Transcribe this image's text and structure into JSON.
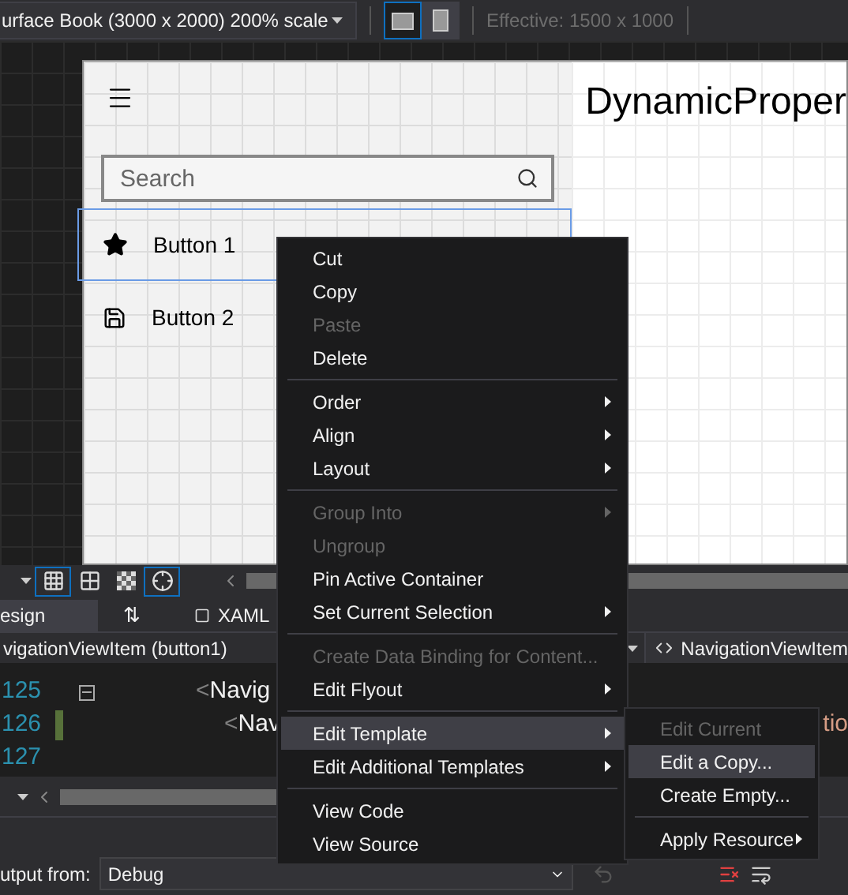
{
  "toolbar": {
    "device": "urface Book (3000 x 2000) 200% scale",
    "orientations": [
      {
        "kind": "landscape",
        "selected": true
      },
      {
        "kind": "portrait",
        "selected": false
      }
    ],
    "effective": "Effective: 1500 x 1000"
  },
  "canvas": {
    "title": "DynamicProper",
    "search": {
      "placeholder": "Search"
    },
    "nav_items": [
      {
        "kind": "star",
        "label": "Button 1",
        "selected": true
      },
      {
        "kind": "save",
        "label": "Button 2",
        "selected": false
      }
    ]
  },
  "view_tools": [
    {
      "kind": "grid",
      "selected": true
    },
    {
      "kind": "snap-grid",
      "selected": false
    },
    {
      "kind": "checker",
      "selected": false
    },
    {
      "kind": "snap-point",
      "selected": true
    }
  ],
  "tabs": [
    {
      "label": "esign",
      "kind": "text",
      "selected": true
    },
    {
      "label": "⇅",
      "kind": "swap",
      "selected": false
    },
    {
      "label": "XAML",
      "kind": "xaml",
      "selected": false
    }
  ],
  "breadcrumb": {
    "left": "vigationViewItem (button1)",
    "right": "NavigationViewItem"
  },
  "code_lines": [
    {
      "number": "125",
      "bracket": "<",
      "text": "Navig",
      "changed": false,
      "collapsible": true,
      "children": [
        {
          "number": "126",
          "bracket": "<",
          "text": "Nav",
          "changed": true,
          "collapsible": false,
          "tail": "tio"
        },
        {
          "number": "127",
          "changed": false,
          "collapsible": false
        }
      ]
    }
  ],
  "output": {
    "label": "utput from:",
    "source": "Debug"
  },
  "context_menu": [
    {
      "kind": "item",
      "label": "Cut",
      "disabled": false,
      "submenu": false,
      "selected": false
    },
    {
      "kind": "item",
      "label": "Copy",
      "disabled": false,
      "submenu": false,
      "selected": false
    },
    {
      "kind": "item",
      "label": "Paste",
      "disabled": true,
      "submenu": false,
      "selected": false
    },
    {
      "kind": "item",
      "label": "Delete",
      "disabled": false,
      "submenu": false,
      "selected": false
    },
    {
      "kind": "separator"
    },
    {
      "kind": "item",
      "label": "Order",
      "disabled": false,
      "submenu": true,
      "selected": false
    },
    {
      "kind": "item",
      "label": "Align",
      "disabled": false,
      "submenu": true,
      "selected": false
    },
    {
      "kind": "item",
      "label": "Layout",
      "disabled": false,
      "submenu": true,
      "selected": false
    },
    {
      "kind": "separator"
    },
    {
      "kind": "item",
      "label": "Group Into",
      "disabled": true,
      "submenu": true,
      "selected": false
    },
    {
      "kind": "item",
      "label": "Ungroup",
      "disabled": true,
      "submenu": false,
      "selected": false
    },
    {
      "kind": "item",
      "label": "Pin Active Container",
      "disabled": false,
      "submenu": false,
      "selected": false
    },
    {
      "kind": "item",
      "label": "Set Current Selection",
      "disabled": false,
      "submenu": true,
      "selected": false
    },
    {
      "kind": "separator"
    },
    {
      "kind": "item",
      "label": "Create Data Binding for Content...",
      "disabled": true,
      "submenu": false,
      "selected": false
    },
    {
      "kind": "item",
      "label": "Edit Flyout",
      "disabled": false,
      "submenu": true,
      "selected": false
    },
    {
      "kind": "separator"
    },
    {
      "kind": "item",
      "label": "Edit Template",
      "disabled": false,
      "submenu": true,
      "selected": true
    },
    {
      "kind": "item",
      "label": "Edit Additional Templates",
      "disabled": false,
      "submenu": true,
      "selected": false
    },
    {
      "kind": "separator"
    },
    {
      "kind": "item",
      "label": "View Code",
      "disabled": false,
      "submenu": false,
      "selected": false
    },
    {
      "kind": "item",
      "label": "View Source",
      "disabled": false,
      "submenu": false,
      "selected": false
    }
  ],
  "submenu": [
    {
      "kind": "item",
      "label": "Edit Current",
      "disabled": true,
      "submenu": false,
      "selected": false
    },
    {
      "kind": "item",
      "label": "Edit a Copy...",
      "disabled": false,
      "submenu": false,
      "selected": true
    },
    {
      "kind": "item",
      "label": "Create Empty...",
      "disabled": false,
      "submenu": false,
      "selected": false
    },
    {
      "kind": "separator"
    },
    {
      "kind": "item",
      "label": "Apply Resource",
      "disabled": false,
      "submenu": true,
      "selected": false
    }
  ]
}
